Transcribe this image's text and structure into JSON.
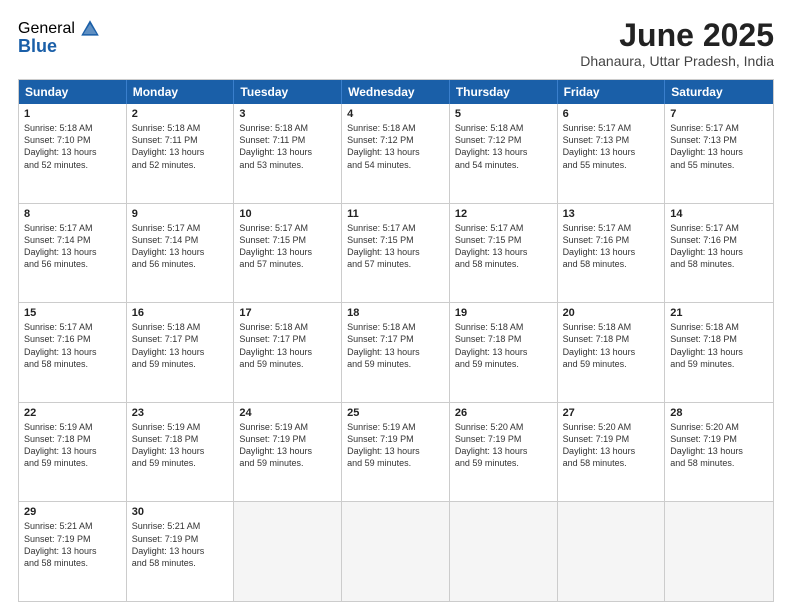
{
  "logo": {
    "general": "General",
    "blue": "Blue"
  },
  "title": "June 2025",
  "location": "Dhanaura, Uttar Pradesh, India",
  "days": [
    "Sunday",
    "Monday",
    "Tuesday",
    "Wednesday",
    "Thursday",
    "Friday",
    "Saturday"
  ],
  "rows": [
    [
      {
        "day": "1",
        "lines": [
          "Sunrise: 5:18 AM",
          "Sunset: 7:10 PM",
          "Daylight: 13 hours",
          "and 52 minutes."
        ]
      },
      {
        "day": "2",
        "lines": [
          "Sunrise: 5:18 AM",
          "Sunset: 7:11 PM",
          "Daylight: 13 hours",
          "and 52 minutes."
        ]
      },
      {
        "day": "3",
        "lines": [
          "Sunrise: 5:18 AM",
          "Sunset: 7:11 PM",
          "Daylight: 13 hours",
          "and 53 minutes."
        ]
      },
      {
        "day": "4",
        "lines": [
          "Sunrise: 5:18 AM",
          "Sunset: 7:12 PM",
          "Daylight: 13 hours",
          "and 54 minutes."
        ]
      },
      {
        "day": "5",
        "lines": [
          "Sunrise: 5:18 AM",
          "Sunset: 7:12 PM",
          "Daylight: 13 hours",
          "and 54 minutes."
        ]
      },
      {
        "day": "6",
        "lines": [
          "Sunrise: 5:17 AM",
          "Sunset: 7:13 PM",
          "Daylight: 13 hours",
          "and 55 minutes."
        ]
      },
      {
        "day": "7",
        "lines": [
          "Sunrise: 5:17 AM",
          "Sunset: 7:13 PM",
          "Daylight: 13 hours",
          "and 55 minutes."
        ]
      }
    ],
    [
      {
        "day": "8",
        "lines": [
          "Sunrise: 5:17 AM",
          "Sunset: 7:14 PM",
          "Daylight: 13 hours",
          "and 56 minutes."
        ]
      },
      {
        "day": "9",
        "lines": [
          "Sunrise: 5:17 AM",
          "Sunset: 7:14 PM",
          "Daylight: 13 hours",
          "and 56 minutes."
        ]
      },
      {
        "day": "10",
        "lines": [
          "Sunrise: 5:17 AM",
          "Sunset: 7:15 PM",
          "Daylight: 13 hours",
          "and 57 minutes."
        ]
      },
      {
        "day": "11",
        "lines": [
          "Sunrise: 5:17 AM",
          "Sunset: 7:15 PM",
          "Daylight: 13 hours",
          "and 57 minutes."
        ]
      },
      {
        "day": "12",
        "lines": [
          "Sunrise: 5:17 AM",
          "Sunset: 7:15 PM",
          "Daylight: 13 hours",
          "and 58 minutes."
        ]
      },
      {
        "day": "13",
        "lines": [
          "Sunrise: 5:17 AM",
          "Sunset: 7:16 PM",
          "Daylight: 13 hours",
          "and 58 minutes."
        ]
      },
      {
        "day": "14",
        "lines": [
          "Sunrise: 5:17 AM",
          "Sunset: 7:16 PM",
          "Daylight: 13 hours",
          "and 58 minutes."
        ]
      }
    ],
    [
      {
        "day": "15",
        "lines": [
          "Sunrise: 5:17 AM",
          "Sunset: 7:16 PM",
          "Daylight: 13 hours",
          "and 58 minutes."
        ]
      },
      {
        "day": "16",
        "lines": [
          "Sunrise: 5:18 AM",
          "Sunset: 7:17 PM",
          "Daylight: 13 hours",
          "and 59 minutes."
        ]
      },
      {
        "day": "17",
        "lines": [
          "Sunrise: 5:18 AM",
          "Sunset: 7:17 PM",
          "Daylight: 13 hours",
          "and 59 minutes."
        ]
      },
      {
        "day": "18",
        "lines": [
          "Sunrise: 5:18 AM",
          "Sunset: 7:17 PM",
          "Daylight: 13 hours",
          "and 59 minutes."
        ]
      },
      {
        "day": "19",
        "lines": [
          "Sunrise: 5:18 AM",
          "Sunset: 7:18 PM",
          "Daylight: 13 hours",
          "and 59 minutes."
        ]
      },
      {
        "day": "20",
        "lines": [
          "Sunrise: 5:18 AM",
          "Sunset: 7:18 PM",
          "Daylight: 13 hours",
          "and 59 minutes."
        ]
      },
      {
        "day": "21",
        "lines": [
          "Sunrise: 5:18 AM",
          "Sunset: 7:18 PM",
          "Daylight: 13 hours",
          "and 59 minutes."
        ]
      }
    ],
    [
      {
        "day": "22",
        "lines": [
          "Sunrise: 5:19 AM",
          "Sunset: 7:18 PM",
          "Daylight: 13 hours",
          "and 59 minutes."
        ]
      },
      {
        "day": "23",
        "lines": [
          "Sunrise: 5:19 AM",
          "Sunset: 7:18 PM",
          "Daylight: 13 hours",
          "and 59 minutes."
        ]
      },
      {
        "day": "24",
        "lines": [
          "Sunrise: 5:19 AM",
          "Sunset: 7:19 PM",
          "Daylight: 13 hours",
          "and 59 minutes."
        ]
      },
      {
        "day": "25",
        "lines": [
          "Sunrise: 5:19 AM",
          "Sunset: 7:19 PM",
          "Daylight: 13 hours",
          "and 59 minutes."
        ]
      },
      {
        "day": "26",
        "lines": [
          "Sunrise: 5:20 AM",
          "Sunset: 7:19 PM",
          "Daylight: 13 hours",
          "and 59 minutes."
        ]
      },
      {
        "day": "27",
        "lines": [
          "Sunrise: 5:20 AM",
          "Sunset: 7:19 PM",
          "Daylight: 13 hours",
          "and 58 minutes."
        ]
      },
      {
        "day": "28",
        "lines": [
          "Sunrise: 5:20 AM",
          "Sunset: 7:19 PM",
          "Daylight: 13 hours",
          "and 58 minutes."
        ]
      }
    ],
    [
      {
        "day": "29",
        "lines": [
          "Sunrise: 5:21 AM",
          "Sunset: 7:19 PM",
          "Daylight: 13 hours",
          "and 58 minutes."
        ]
      },
      {
        "day": "30",
        "lines": [
          "Sunrise: 5:21 AM",
          "Sunset: 7:19 PM",
          "Daylight: 13 hours",
          "and 58 minutes."
        ]
      },
      {
        "day": "",
        "lines": []
      },
      {
        "day": "",
        "lines": []
      },
      {
        "day": "",
        "lines": []
      },
      {
        "day": "",
        "lines": []
      },
      {
        "day": "",
        "lines": []
      }
    ]
  ]
}
